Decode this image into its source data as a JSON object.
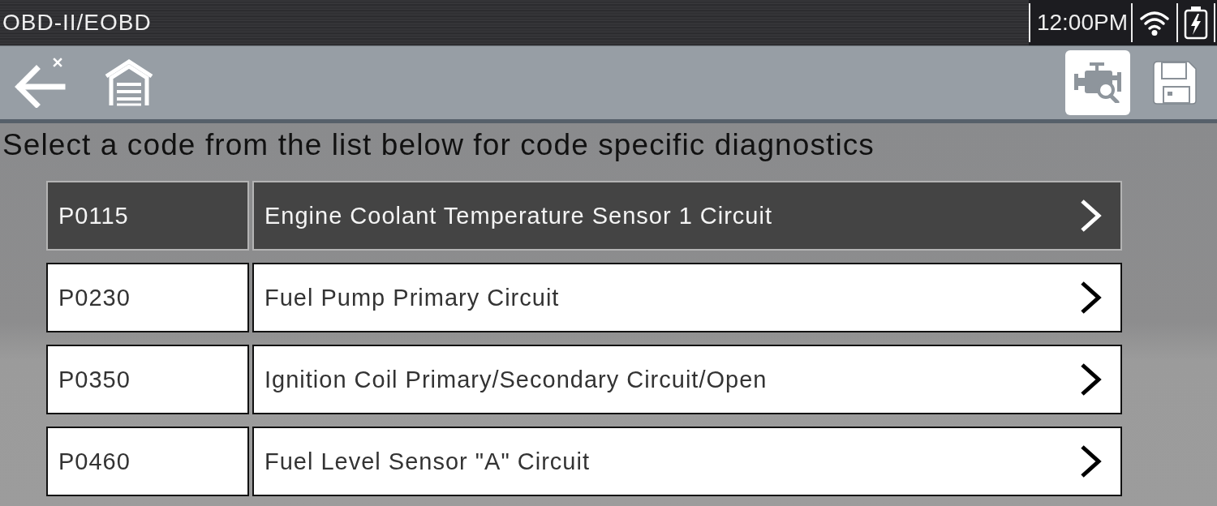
{
  "status_bar": {
    "title": "OBD-II/EOBD",
    "time": "12:00PM"
  },
  "toolbar": [
    {
      "kind": "back",
      "selected": false
    },
    {
      "kind": "garage",
      "selected": false
    },
    {
      "kind": "engine-search",
      "selected": true
    },
    {
      "kind": "save",
      "selected": false
    }
  ],
  "instruction": "Select a code from the list below for code specific diagnostics",
  "codes": [
    {
      "code": "P0115",
      "description": "Engine Coolant Temperature Sensor 1 Circuit",
      "selected": true
    },
    {
      "code": "P0230",
      "description": "Fuel Pump Primary Circuit",
      "selected": false
    },
    {
      "code": "P0350",
      "description": "Ignition Coil Primary/Secondary Circuit/Open",
      "selected": false
    },
    {
      "code": "P0460",
      "description": "Fuel Level Sensor \"A\" Circuit",
      "selected": false
    }
  ]
}
